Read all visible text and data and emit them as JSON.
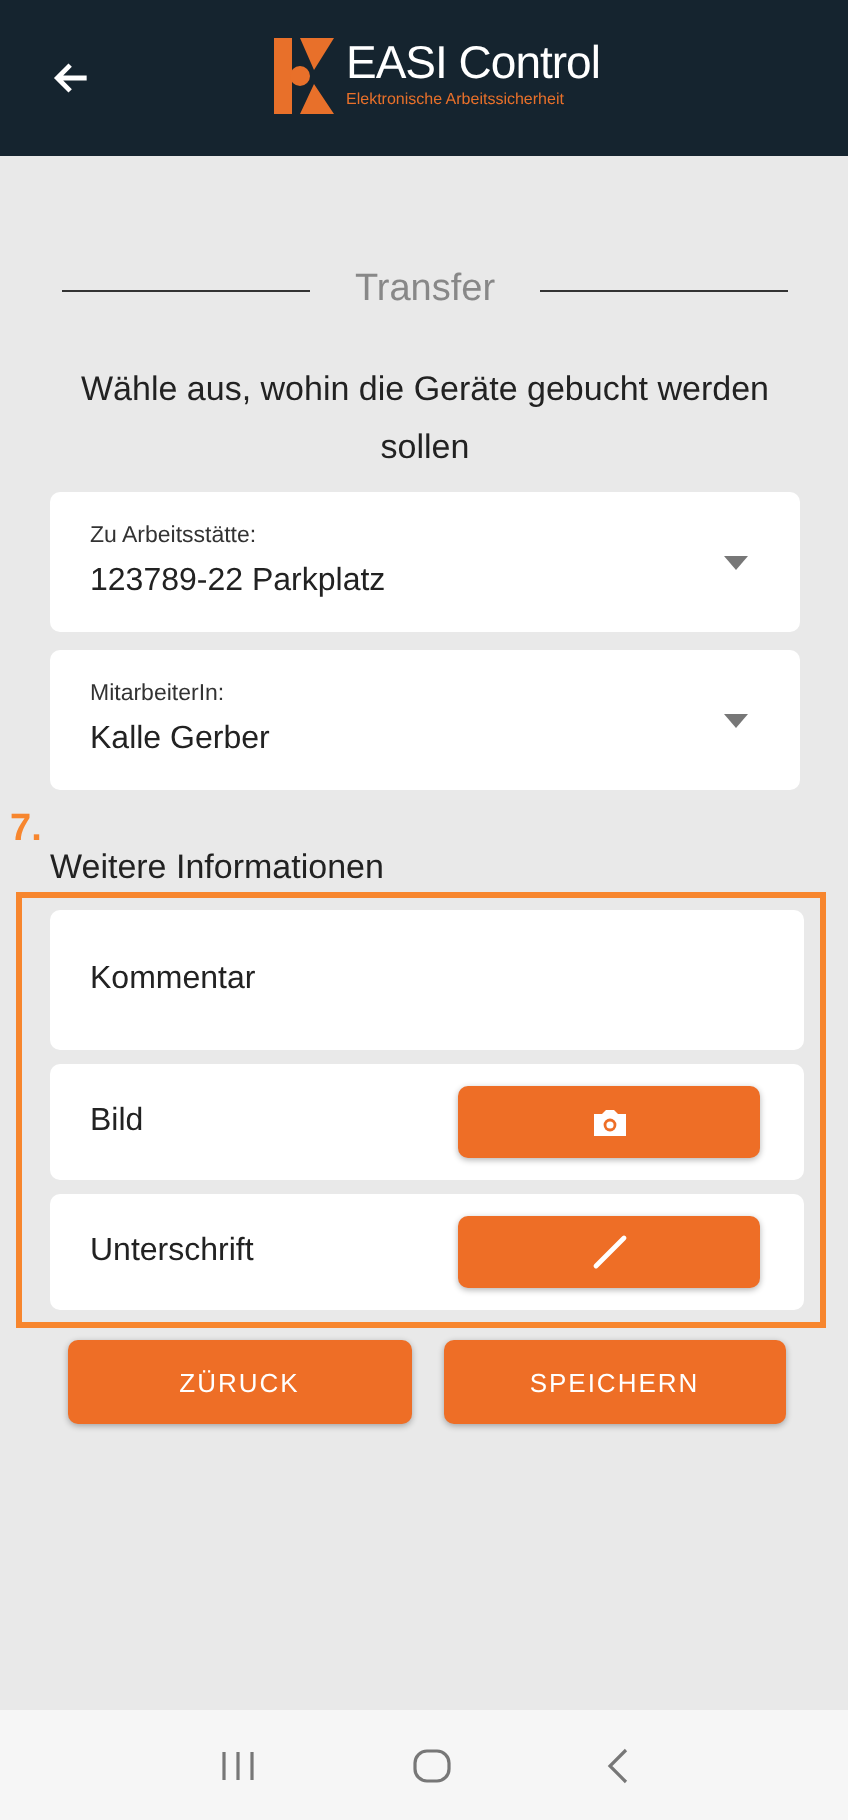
{
  "header": {
    "title": "EASI Control",
    "subtitle": "Elektronische Arbeitssicherheit"
  },
  "section_title": "Transfer",
  "instruction": "Wähle aus, wohin die Geräte gebucht werden sollen",
  "dropdowns": [
    {
      "label": "Zu Arbeitsstätte:",
      "value": "123789-22 Parkplatz"
    },
    {
      "label": "MitarbeiterIn:",
      "value": "Kalle Gerber"
    }
  ],
  "annotation": {
    "number": "7."
  },
  "more_info": {
    "title": "Weitere Informationen",
    "rows": [
      {
        "kind": "comment",
        "label": "Kommentar"
      },
      {
        "kind": "image",
        "label": "Bild"
      },
      {
        "kind": "signature",
        "label": "Unterschrift"
      }
    ]
  },
  "buttons": [
    "ZÜRUCK",
    "SPEICHERN"
  ]
}
